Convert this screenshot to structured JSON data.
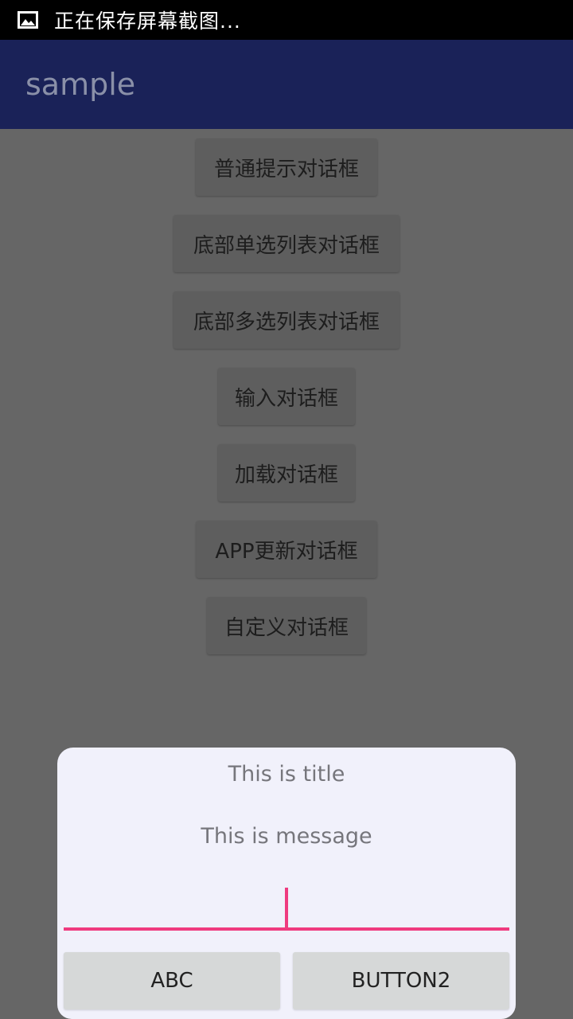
{
  "status_bar": {
    "notification_icon": "image-icon",
    "text": "正在保存屏幕截图..."
  },
  "app_bar": {
    "title": "sample"
  },
  "menu": {
    "buttons": [
      {
        "label": "普通提示对话框"
      },
      {
        "label": "底部单选列表对话框"
      },
      {
        "label": "底部多选列表对话框"
      },
      {
        "label": "输入对话框"
      },
      {
        "label": "加载对话框"
      },
      {
        "label": "APP更新对话框"
      },
      {
        "label": "自定义对话框"
      }
    ]
  },
  "dialog": {
    "title": "This is title",
    "message": "This is message",
    "input_value": "",
    "accent_color": "#ef3b7f",
    "buttons": [
      {
        "label": "ABC"
      },
      {
        "label": "BUTTON2"
      }
    ]
  }
}
